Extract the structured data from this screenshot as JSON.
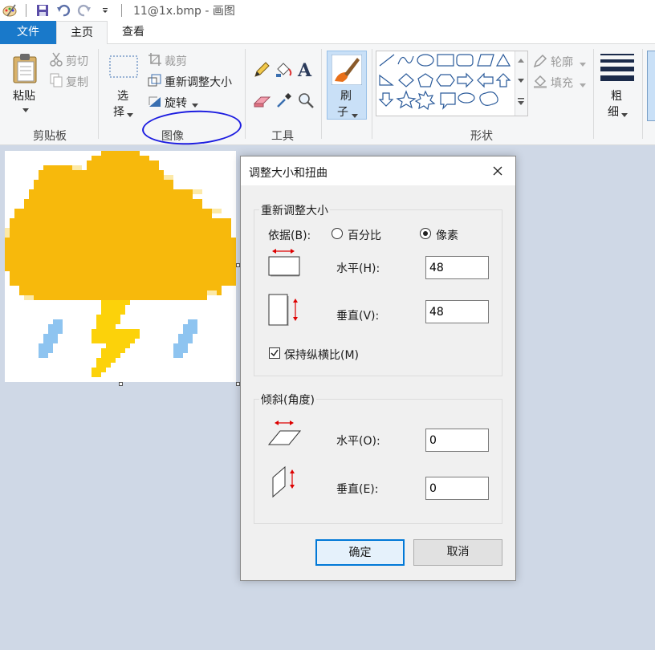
{
  "titlebar": {
    "title": "11@1x.bmp - 画图"
  },
  "tabs": {
    "file": "文件",
    "home": "主页",
    "view": "查看"
  },
  "ribbon": {
    "clipboard": {
      "paste": "粘贴",
      "cut": "剪切",
      "copy": "复制",
      "group": "剪贴板"
    },
    "image": {
      "select_line1": "选",
      "select_line2": "择",
      "crop": "裁剪",
      "resize": "重新调整大小",
      "rotate": "旋转",
      "group": "图像"
    },
    "tools": {
      "group": "工具",
      "text_glyph": "A"
    },
    "brush": {
      "label": "刷",
      "label2": "子"
    },
    "shapes": {
      "outline": "轮廓",
      "fill": "填充",
      "group": "形状"
    },
    "size": {
      "line1": "粗",
      "line2": "细"
    }
  },
  "dialog": {
    "title": "调整大小和扭曲",
    "resize_section": "重新调整大小",
    "by_label": "依据(B):",
    "percent": "百分比",
    "pixels": "像素",
    "selected_mode": "pixels",
    "horizontal_label": "水平(H):",
    "horizontal_value": "48",
    "vertical_label": "垂直(V):",
    "vertical_value": "48",
    "keep_ratio": "保持纵横比(M)",
    "keep_ratio_checked": true,
    "skew_section": "倾斜(角度)",
    "skew_h_label": "水平(O):",
    "skew_h_value": "0",
    "skew_v_label": "垂直(E):",
    "skew_v_value": "0",
    "ok": "确定",
    "cancel": "取消"
  },
  "colors": {
    "accent_blue": "#1979ca",
    "cloud_yellow": "#f7b90c",
    "bolt_yellow": "#fcd20a",
    "rain_blue": "#8ec4f0",
    "annotation_blue": "#1c1ce0"
  }
}
